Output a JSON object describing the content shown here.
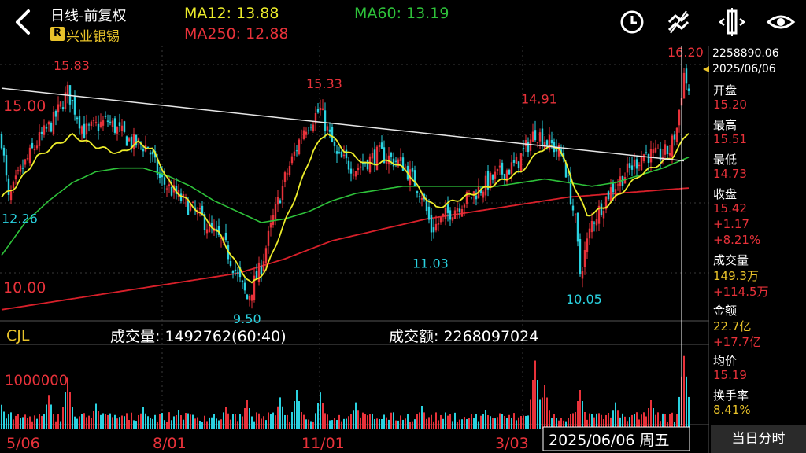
{
  "header": {
    "title": "日线-前复权",
    "badge": "R",
    "stock_name": "兴业银锡",
    "ma12": "MA12: 13.88",
    "ma60": "MA60: 13.19",
    "ma250": "MA250: 12.88"
  },
  "colors": {
    "up": "#e8323a",
    "down": "#2ad2e0",
    "ma12": "#ecec2a",
    "ma60": "#2ec23a",
    "ma250": "#d8202a",
    "accent": "#e8c22a",
    "crosshair": "#ffffff"
  },
  "icons": [
    "back-arrow-icon",
    "clock-icon",
    "chart-toggle-icon",
    "adjust-icon",
    "eye-icon"
  ],
  "price_axis": {
    "labels": [
      "15.00",
      "10.00"
    ],
    "values": [
      15.0,
      10.0
    ]
  },
  "annotations": [
    {
      "text": "15.83",
      "value": 15.83,
      "idx": 28
    },
    {
      "text": "15.33",
      "value": 15.33,
      "idx": 135
    },
    {
      "text": "14.91",
      "value": 14.91,
      "idx": 226
    },
    {
      "text": "16.20",
      "value": 16.2,
      "idx": 289
    },
    {
      "text": "12.26",
      "value": 12.26,
      "idx": 3
    },
    {
      "text": "9.50",
      "value": 9.5,
      "idx": 104
    },
    {
      "text": "11.03",
      "value": 11.03,
      "idx": 180
    },
    {
      "text": "10.05",
      "value": 10.05,
      "idx": 245
    }
  ],
  "volume_panel": {
    "name": "CJL",
    "vol_text": "成交量: 1492762(60:40)",
    "amount_text": "成交额: 2268097024",
    "axis_label": "1000000",
    "axis_value": 1000000
  },
  "dates": [
    "5/06",
    "8/01",
    "11/01",
    "3/03"
  ],
  "date_idx": [
    0,
    62,
    125,
    207
  ],
  "crosshair": {
    "date_label": "2025/06/06 周五",
    "price_box": "2258890.06",
    "date_box": "2025/06/06"
  },
  "side_panel": {
    "open_label": "开盘",
    "open": "15.20",
    "high_label": "最高",
    "high": "15.51",
    "low_label": "最低",
    "low": "14.73",
    "close_label": "收盘",
    "close": "15.42",
    "change": "+1.17",
    "change_pct": "+8.21%",
    "volume_label": "成交量",
    "volume": "149.3万",
    "volume_change": "+114.5万",
    "amount_label": "金额",
    "amount": "22.7亿",
    "amount_change": "+17.7亿",
    "avg_label": "均价",
    "avg": "15.19",
    "turnover_label": "换手率",
    "turnover": "8.41%"
  },
  "bottom_button": "当日分时",
  "chart_data": {
    "type": "candlestick",
    "count": 292,
    "ylim": [
      9.2,
      16.5
    ],
    "anchors_close": [
      [
        0,
        14.1
      ],
      [
        3,
        12.4
      ],
      [
        8,
        13.2
      ],
      [
        15,
        14.0
      ],
      [
        22,
        14.6
      ],
      [
        28,
        15.4
      ],
      [
        35,
        14.3
      ],
      [
        45,
        14.6
      ],
      [
        55,
        14.0
      ],
      [
        62,
        13.9
      ],
      [
        67,
        13.0
      ],
      [
        75,
        12.5
      ],
      [
        85,
        11.9
      ],
      [
        95,
        11.1
      ],
      [
        104,
        9.7
      ],
      [
        110,
        10.6
      ],
      [
        115,
        11.9
      ],
      [
        120,
        13.0
      ],
      [
        128,
        14.4
      ],
      [
        135,
        14.9
      ],
      [
        142,
        13.6
      ],
      [
        150,
        13.3
      ],
      [
        160,
        13.7
      ],
      [
        170,
        13.4
      ],
      [
        178,
        12.6
      ],
      [
        182,
        11.6
      ],
      [
        190,
        12.1
      ],
      [
        200,
        12.6
      ],
      [
        210,
        13.1
      ],
      [
        218,
        13.4
      ],
      [
        226,
        14.3
      ],
      [
        232,
        14.0
      ],
      [
        238,
        13.6
      ],
      [
        243,
        11.8
      ],
      [
        245,
        10.4
      ],
      [
        250,
        11.8
      ],
      [
        258,
        12.7
      ],
      [
        265,
        13.2
      ],
      [
        272,
        13.7
      ],
      [
        278,
        13.6
      ],
      [
        283,
        13.8
      ],
      [
        286,
        14.4
      ],
      [
        289,
        15.9
      ],
      [
        291,
        15.42
      ]
    ],
    "ma12_anchors": [
      [
        0,
        12.5
      ],
      [
        6,
        12.8
      ],
      [
        15,
        13.6
      ],
      [
        22,
        13.9
      ],
      [
        30,
        14.2
      ],
      [
        40,
        13.9
      ],
      [
        50,
        13.7
      ],
      [
        58,
        14.0
      ],
      [
        64,
        13.8
      ],
      [
        72,
        12.8
      ],
      [
        82,
        12.2
      ],
      [
        92,
        11.5
      ],
      [
        100,
        10.6
      ],
      [
        106,
        10.1
      ],
      [
        112,
        10.5
      ],
      [
        118,
        11.5
      ],
      [
        125,
        12.6
      ],
      [
        132,
        13.8
      ],
      [
        138,
        14.3
      ],
      [
        145,
        13.8
      ],
      [
        155,
        13.4
      ],
      [
        165,
        13.5
      ],
      [
        172,
        13.2
      ],
      [
        178,
        12.6
      ],
      [
        184,
        12.2
      ],
      [
        192,
        12.4
      ],
      [
        200,
        12.6
      ],
      [
        210,
        12.9
      ],
      [
        220,
        13.2
      ],
      [
        228,
        13.8
      ],
      [
        236,
        13.9
      ],
      [
        242,
        12.9
      ],
      [
        248,
        12.0
      ],
      [
        255,
        12.2
      ],
      [
        262,
        12.6
      ],
      [
        270,
        13.1
      ],
      [
        278,
        13.4
      ],
      [
        284,
        13.6
      ],
      [
        289,
        14.1
      ],
      [
        291,
        14.3
      ]
    ],
    "ma60_anchors": [
      [
        0,
        10.9
      ],
      [
        10,
        11.8
      ],
      [
        20,
        12.4
      ],
      [
        30,
        12.9
      ],
      [
        40,
        13.2
      ],
      [
        50,
        13.3
      ],
      [
        60,
        13.3
      ],
      [
        70,
        13.1
      ],
      [
        80,
        12.8
      ],
      [
        90,
        12.4
      ],
      [
        100,
        12.1
      ],
      [
        110,
        11.8
      ],
      [
        120,
        11.9
      ],
      [
        130,
        12.1
      ],
      [
        140,
        12.4
      ],
      [
        150,
        12.6
      ],
      [
        160,
        12.7
      ],
      [
        170,
        12.8
      ],
      [
        180,
        12.8
      ],
      [
        190,
        12.8
      ],
      [
        200,
        12.8
      ],
      [
        210,
        12.8
      ],
      [
        220,
        12.9
      ],
      [
        230,
        13.0
      ],
      [
        240,
        12.9
      ],
      [
        250,
        12.8
      ],
      [
        260,
        12.9
      ],
      [
        270,
        13.1
      ],
      [
        280,
        13.3
      ],
      [
        291,
        13.6
      ]
    ],
    "ma250_anchors": [
      [
        0,
        9.4
      ],
      [
        20,
        9.6
      ],
      [
        40,
        9.8
      ],
      [
        60,
        10.0
      ],
      [
        80,
        10.2
      ],
      [
        100,
        10.4
      ],
      [
        120,
        10.8
      ],
      [
        140,
        11.3
      ],
      [
        160,
        11.6
      ],
      [
        180,
        11.9
      ],
      [
        200,
        12.1
      ],
      [
        220,
        12.3
      ],
      [
        240,
        12.5
      ],
      [
        260,
        12.6
      ],
      [
        280,
        12.7
      ],
      [
        291,
        12.75
      ]
    ],
    "trendline": [
      [
        0,
        15.5
      ],
      [
        289,
        13.5
      ]
    ],
    "volume_spikes": [
      [
        0,
        500000
      ],
      [
        20,
        700000
      ],
      [
        28,
        1050000
      ],
      [
        40,
        520000
      ],
      [
        60,
        450000
      ],
      [
        75,
        400000
      ],
      [
        95,
        450000
      ],
      [
        104,
        600000
      ],
      [
        118,
        650000
      ],
      [
        125,
        800000
      ],
      [
        135,
        750000
      ],
      [
        150,
        550000
      ],
      [
        178,
        480000
      ],
      [
        205,
        400000
      ],
      [
        226,
        1400000
      ],
      [
        230,
        900000
      ],
      [
        245,
        800000
      ],
      [
        260,
        550000
      ],
      [
        275,
        600000
      ],
      [
        289,
        1492762
      ]
    ]
  }
}
